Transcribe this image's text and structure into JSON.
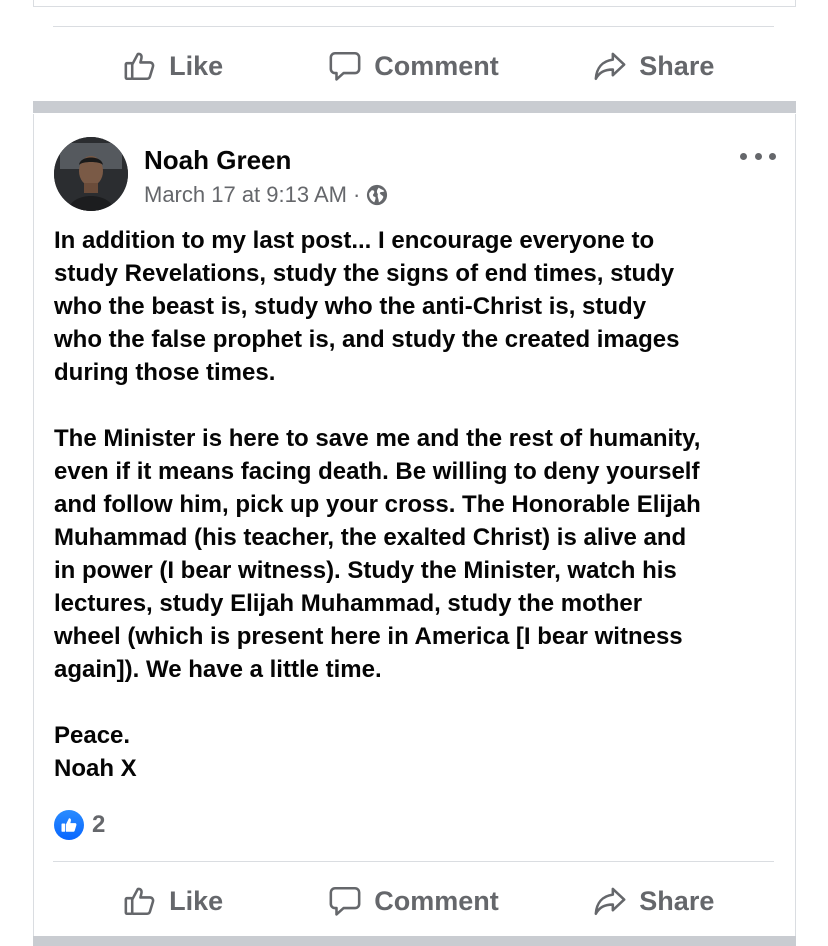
{
  "top_actions": {
    "like": "Like",
    "comment": "Comment",
    "share": "Share"
  },
  "post": {
    "author": "Noah Green",
    "timestamp": "March 17 at 9:13 AM",
    "separator": "·",
    "privacy_icon": "globe-icon",
    "paragraphs": [
      [
        "In addition to my last post... I encourage everyone to",
        "study Revelations, study the signs of end times, study",
        "who the beast is, study who the anti-Christ is, study",
        "who the false prophet is, and study the created images",
        "during those times."
      ],
      [
        "The Minister is here to save me and the rest of humanity,",
        "even if it means facing death. Be willing to deny yourself",
        "and follow him, pick up your cross. The Honorable Elijah",
        "Muhammad (his teacher, the exalted Christ) is alive and",
        "in power (I bear witness). Study the Minister, watch his",
        "lectures, study Elijah Muhammad, study the mother",
        "wheel (which is present here in America [I bear witness",
        "again]). We have a little time."
      ],
      [
        "Peace.",
        "Noah X"
      ]
    ],
    "reaction_icon": "like-reaction-icon",
    "reaction_count": "2"
  },
  "bottom_actions": {
    "like": "Like",
    "comment": "Comment",
    "share": "Share"
  },
  "colors": {
    "accent": "#0866ff",
    "muted": "#65676b",
    "text": "#050505",
    "separator": "#c9ccd1"
  }
}
